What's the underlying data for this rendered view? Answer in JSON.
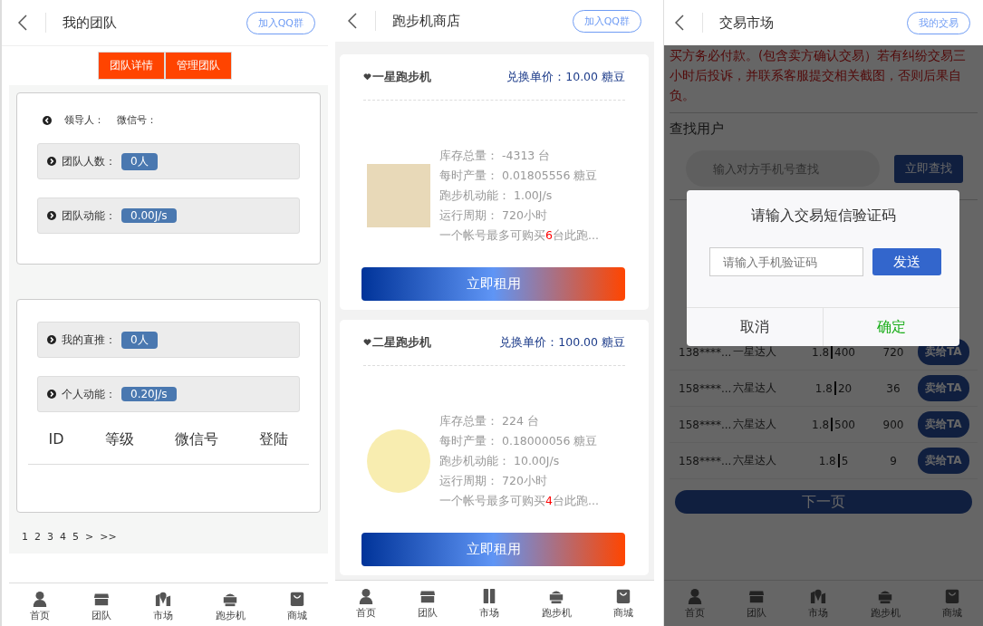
{
  "team_page": {
    "header": {
      "title": "我的团队",
      "button": "加入QQ群"
    },
    "tabs": [
      "团队详情",
      "管理团队"
    ],
    "leader": {
      "leader_label": "领导人：",
      "wechat_label": "微信号："
    },
    "team_stats": [
      {
        "label": "团队人数：",
        "value": "0人"
      },
      {
        "label": "团队动能：",
        "value": "0.00J/s"
      }
    ],
    "my_stats": [
      {
        "label": "我的直推：",
        "value": "0人"
      },
      {
        "label": "个人动能：",
        "value": "0.20J/s"
      }
    ],
    "table": {
      "columns": [
        "ID",
        "等级",
        "微信号",
        "登陆"
      ]
    },
    "pagination": [
      "1",
      "2",
      "3",
      "4",
      "5",
      ">",
      ">>"
    ],
    "nav": [
      {
        "label": "首页",
        "kind": "person"
      },
      {
        "label": "团队",
        "kind": "store"
      },
      {
        "label": "市场",
        "kind": "map"
      },
      {
        "label": "跑步机",
        "kind": "cart"
      },
      {
        "label": "商城",
        "kind": "bag"
      }
    ]
  },
  "shop_page": {
    "header": {
      "title": "跑步机商店",
      "button": "加入QQ群"
    },
    "products": [
      {
        "name": "一星跑步机",
        "price_label": "兑换单价：",
        "price": "10.00 糖豆",
        "specs": [
          {
            "label": "库存总量：",
            "value": "-4313 台"
          },
          {
            "label": "每时产量：",
            "value": "0.01805556 糖豆"
          },
          {
            "label": "跑步机动能：",
            "value": "1.00J/s"
          },
          {
            "label": "运行周期：",
            "value": "720小时"
          }
        ],
        "limit_prefix": "一个帐号最多可购买",
        "limit_count": "6",
        "limit_suffix": "台此跑...",
        "button": "立即租用"
      },
      {
        "name": "二星跑步机",
        "price_label": "兑换单价：",
        "price": "100.00 糖豆",
        "specs": [
          {
            "label": "库存总量：",
            "value": "224 台"
          },
          {
            "label": "每时产量：",
            "value": "0.18000056 糖豆"
          },
          {
            "label": "跑步机动能：",
            "value": "10.00J/s"
          },
          {
            "label": "运行周期：",
            "value": "720小时"
          }
        ],
        "limit_prefix": "一个帐号最多可购买",
        "limit_count": "4",
        "limit_suffix": "台此跑...",
        "button": "立即租用"
      }
    ],
    "nav": [
      {
        "label": "首页",
        "kind": "person"
      },
      {
        "label": "团队",
        "kind": "store"
      },
      {
        "label": "市场",
        "kind": "columns"
      },
      {
        "label": "跑步机",
        "kind": "cart"
      },
      {
        "label": "商城",
        "kind": "bag"
      }
    ]
  },
  "market_page": {
    "header": {
      "title": "交易市场",
      "button": "我的交易"
    },
    "notice": "买方务必付款。(包含卖方确认交易）若有纠纷交易三小时后投诉，并联系客服提交相关截图，否则后果自负。",
    "search": {
      "label": "查找用户",
      "placeholder": "输入对方手机号查找",
      "button": "立即查找"
    },
    "rows": [
      {
        "phone": "138****...",
        "level": "一星达人",
        "price": "1.8",
        "quantity": "400",
        "total": "720",
        "action": "卖给TA"
      },
      {
        "phone": "158****...",
        "level": "六星达人",
        "price": "1.8",
        "quantity": "20",
        "total": "36",
        "action": "卖给TA"
      },
      {
        "phone": "158****...",
        "level": "六星达人",
        "price": "1.8",
        "quantity": "500",
        "total": "900",
        "action": "卖给TA"
      },
      {
        "phone": "158****...",
        "level": "六星达人",
        "price": "1.8",
        "quantity": "5",
        "total": "9",
        "action": "卖给TA"
      }
    ],
    "next_button": "下一页",
    "dialog": {
      "title": "请输入交易短信验证码",
      "placeholder": "请输入手机验证码",
      "send": "发送",
      "cancel": "取消",
      "confirm": "确定"
    },
    "nav": [
      {
        "label": "首页",
        "kind": "person"
      },
      {
        "label": "团队",
        "kind": "store"
      },
      {
        "label": "市场",
        "kind": "map"
      },
      {
        "label": "跑步机",
        "kind": "cart"
      },
      {
        "label": "商城",
        "kind": "bag"
      }
    ]
  }
}
